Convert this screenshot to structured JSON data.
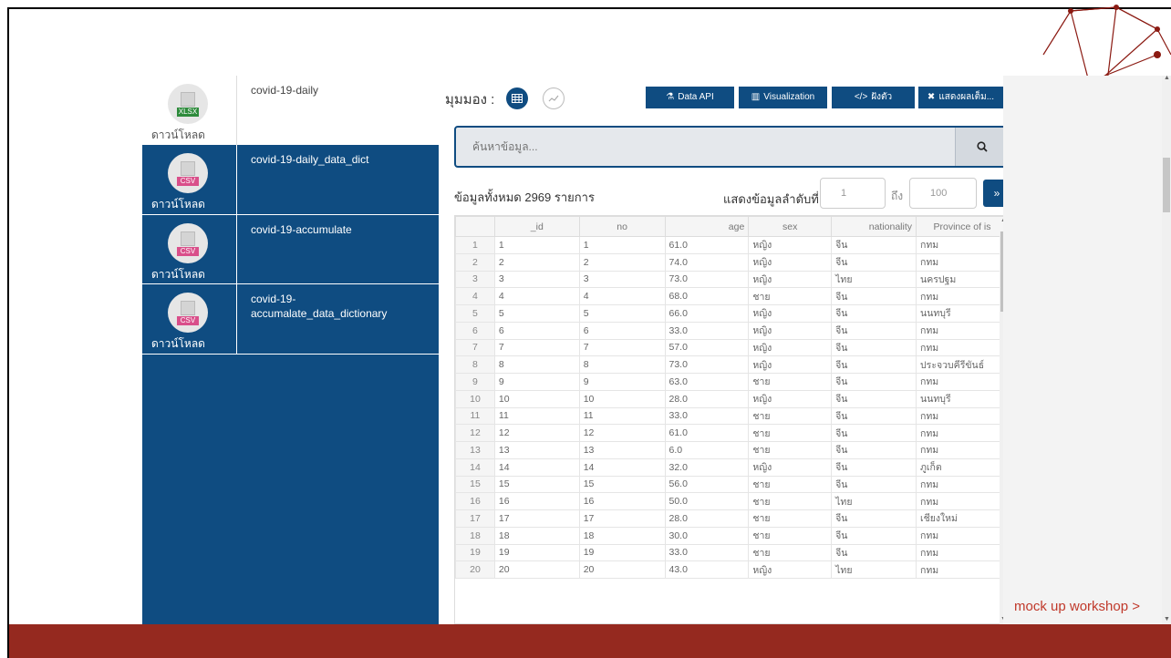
{
  "sidebar": {
    "files": [
      {
        "name": "covid-19-daily",
        "type": "XLSX",
        "download": "ดาวน์โหลด"
      },
      {
        "name": "covid-19-daily_data_dict",
        "type": "CSV",
        "download": "ดาวน์โหลด"
      },
      {
        "name": "covid-19-accumulate",
        "type": "CSV",
        "download": "ดาวน์โหลด"
      },
      {
        "name": "covid-19-accumalate_data_dictionary",
        "type": "CSV",
        "download": "ดาวน์โหลด"
      }
    ]
  },
  "toolbar": {
    "view_label": "มุมมอง :",
    "buttons": [
      "Data API",
      "Visualization",
      "ฝังตัว",
      "แสดงผลเต็ม..."
    ]
  },
  "search": {
    "placeholder": "ค้นหาข้อมูล..."
  },
  "summary": {
    "total": "ข้อมูลทั้งหมด 2969 รายการ",
    "range_label": "แสดงข้อมูลลำดับที่",
    "from": "1",
    "to_label": "ถึง",
    "to": "100",
    "go": "»"
  },
  "table": {
    "columns": [
      "_id",
      "no",
      "age",
      "sex",
      "nationality",
      "Province of is"
    ],
    "rows": [
      [
        "1",
        "1",
        "1",
        "61.0",
        "หญิง",
        "จีน",
        "กทม"
      ],
      [
        "2",
        "2",
        "2",
        "74.0",
        "หญิง",
        "จีน",
        "กทม"
      ],
      [
        "3",
        "3",
        "3",
        "73.0",
        "หญิง",
        "ไทย",
        "นครปฐม"
      ],
      [
        "4",
        "4",
        "4",
        "68.0",
        "ชาย",
        "จีน",
        "กทม"
      ],
      [
        "5",
        "5",
        "5",
        "66.0",
        "หญิง",
        "จีน",
        "นนทบุรี"
      ],
      [
        "6",
        "6",
        "6",
        "33.0",
        "หญิง",
        "จีน",
        "กทม"
      ],
      [
        "7",
        "7",
        "7",
        "57.0",
        "หญิง",
        "จีน",
        "กทม"
      ],
      [
        "8",
        "8",
        "8",
        "73.0",
        "หญิง",
        "จีน",
        "ประจวบคีรีขันธ์"
      ],
      [
        "9",
        "9",
        "9",
        "63.0",
        "ชาย",
        "จีน",
        "กทม"
      ],
      [
        "10",
        "10",
        "10",
        "28.0",
        "หญิง",
        "จีน",
        "นนทบุรี"
      ],
      [
        "11",
        "11",
        "11",
        "33.0",
        "ชาย",
        "จีน",
        "กทม"
      ],
      [
        "12",
        "12",
        "12",
        "61.0",
        "ชาย",
        "จีน",
        "กทม"
      ],
      [
        "13",
        "13",
        "13",
        "6.0",
        "ชาย",
        "จีน",
        "กทม"
      ],
      [
        "14",
        "14",
        "14",
        "32.0",
        "หญิง",
        "จีน",
        "ภูเก็ต"
      ],
      [
        "15",
        "15",
        "15",
        "56.0",
        "ชาย",
        "จีน",
        "กทม"
      ],
      [
        "16",
        "16",
        "16",
        "50.0",
        "ชาย",
        "ไทย",
        "กทม"
      ],
      [
        "17",
        "17",
        "17",
        "28.0",
        "ชาย",
        "จีน",
        "เชียงใหม่"
      ],
      [
        "18",
        "18",
        "18",
        "30.0",
        "ชาย",
        "จีน",
        "กทม"
      ],
      [
        "19",
        "19",
        "19",
        "33.0",
        "ชาย",
        "จีน",
        "กทม"
      ],
      [
        "20",
        "20",
        "20",
        "43.0",
        "หญิง",
        "ไทย",
        "กทม"
      ]
    ]
  },
  "footer": {
    "mock_label": "mock up workshop >"
  },
  "colors": {
    "primary": "#0f4c81",
    "footer": "#95291f",
    "accent_text": "#c0392b"
  }
}
